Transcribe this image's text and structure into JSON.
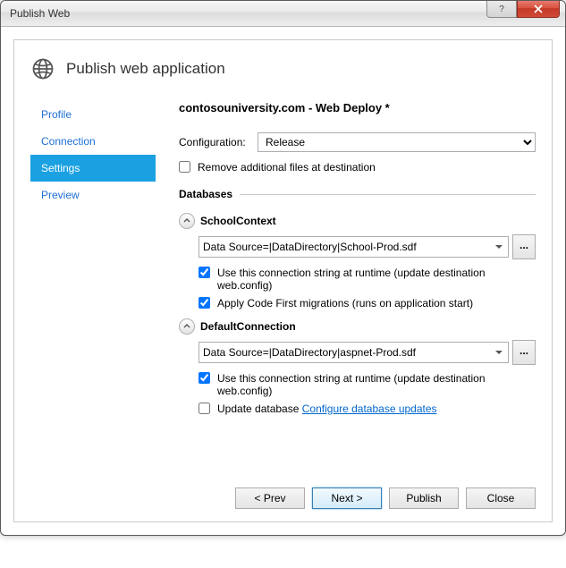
{
  "window": {
    "title": "Publish Web"
  },
  "header": {
    "heading": "Publish web application"
  },
  "nav": {
    "items": [
      {
        "label": "Profile"
      },
      {
        "label": "Connection"
      },
      {
        "label": "Settings"
      },
      {
        "label": "Preview"
      }
    ],
    "active_index": 2
  },
  "main": {
    "profile_title": "contosouniversity.com - Web Deploy *",
    "config_label": "Configuration:",
    "config_value": "Release",
    "remove_files_label": "Remove additional files at destination",
    "databases_heading": "Databases",
    "browse_label": "...",
    "dbs": [
      {
        "name": "SchoolContext",
        "conn": "Data Source=|DataDirectory|School-Prod.sdf",
        "use_runtime_label": "Use this connection string at runtime (update destination web.config)",
        "use_runtime_checked": true,
        "second_label": "Apply Code First migrations (runs on application start)",
        "second_checked": true,
        "second_link": null
      },
      {
        "name": "DefaultConnection",
        "conn": "Data Source=|DataDirectory|aspnet-Prod.sdf",
        "use_runtime_label": "Use this connection string at runtime (update destination web.config)",
        "use_runtime_checked": true,
        "second_label": "Update database",
        "second_checked": false,
        "second_link": "Configure database updates"
      }
    ]
  },
  "footer": {
    "prev": "< Prev",
    "next": "Next >",
    "publish": "Publish",
    "close": "Close"
  }
}
